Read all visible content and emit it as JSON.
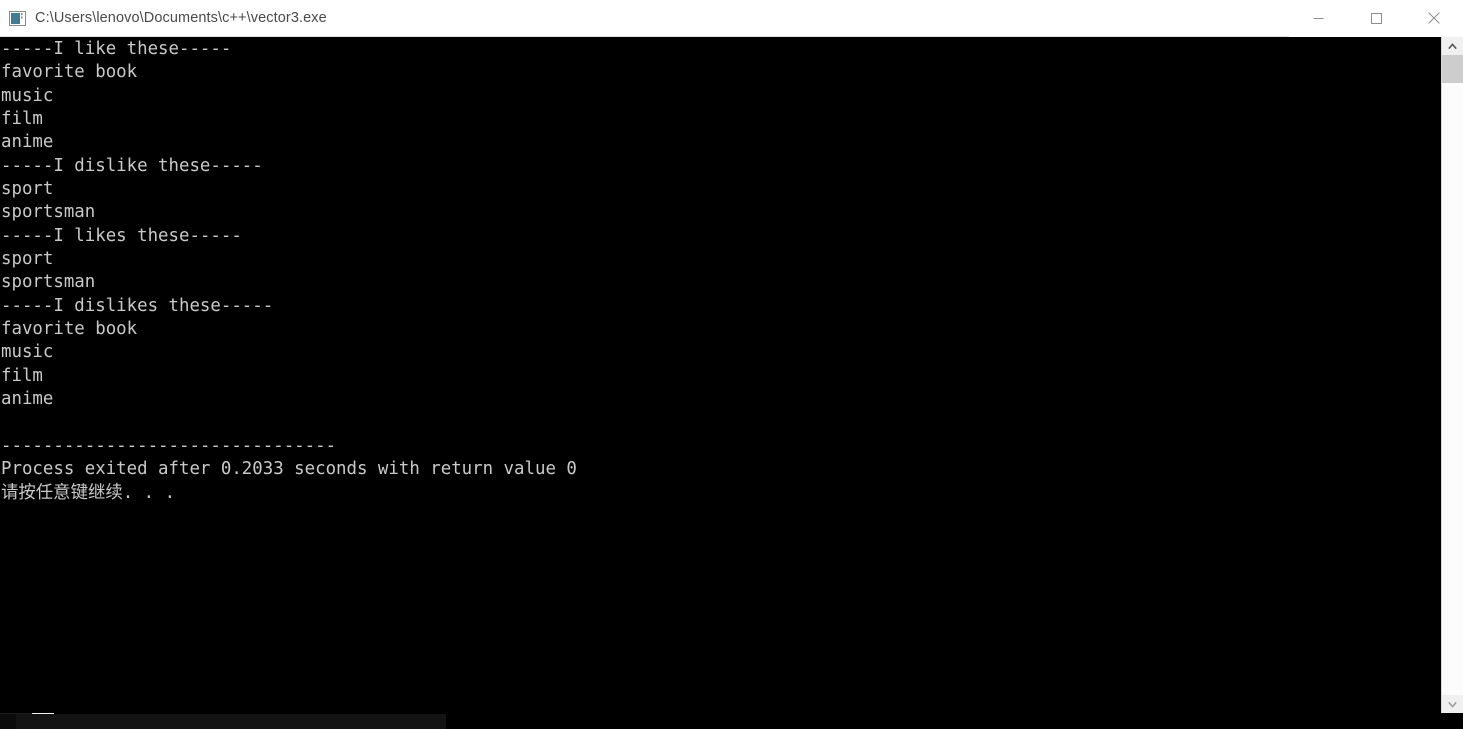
{
  "window": {
    "title": "C:\\Users\\lenovo\\Documents\\c++\\vector3.exe",
    "icon": "console-app-icon",
    "background_color": "#000000",
    "titlebar_color": "#ffffff",
    "text_color": "#c9c9c9"
  },
  "titlebar_buttons": [
    {
      "name": "minimize-button",
      "glyph": "minimize-icon",
      "label": "Minimize"
    },
    {
      "name": "maximize-button",
      "glyph": "maximize-icon",
      "label": "Maximize"
    },
    {
      "name": "close-button",
      "glyph": "close-icon",
      "label": "Close"
    }
  ],
  "console": {
    "lines": [
      "-----I like these-----",
      "favorite book",
      "music",
      "film",
      "anime",
      "-----I dislike these-----",
      "sport",
      "sportsman",
      "-----I likes these-----",
      "sport",
      "sportsman",
      "-----I dislikes these-----",
      "favorite book",
      "music",
      "film",
      "anime",
      "",
      "--------------------------------",
      "Process exited after 0.2033 seconds with return value 0",
      "请按任意键继续. . ."
    ],
    "full_text": "-----I like these-----\nfavorite book\nmusic\nfilm\nanime\n-----I dislike these-----\nsport\nsportsman\n-----I likes these-----\nsport\nsportsman\n-----I dislikes these-----\nfavorite book\nmusic\nfilm\nanime\n\n--------------------------------\nProcess exited after 0.2033 seconds with return value 0\n请按任意键继续. . .",
    "exit_info": {
      "elapsed_seconds": "0.2033",
      "return_value": "0",
      "prompt": "请按任意键继续. . ."
    }
  },
  "scrollbars": {
    "vertical": {
      "up_arrow": "chevron-up-icon",
      "down_arrow": "chevron-down-icon",
      "thumb_position_percent": 0
    },
    "horizontal": {
      "thumb_position_percent": 0
    }
  }
}
